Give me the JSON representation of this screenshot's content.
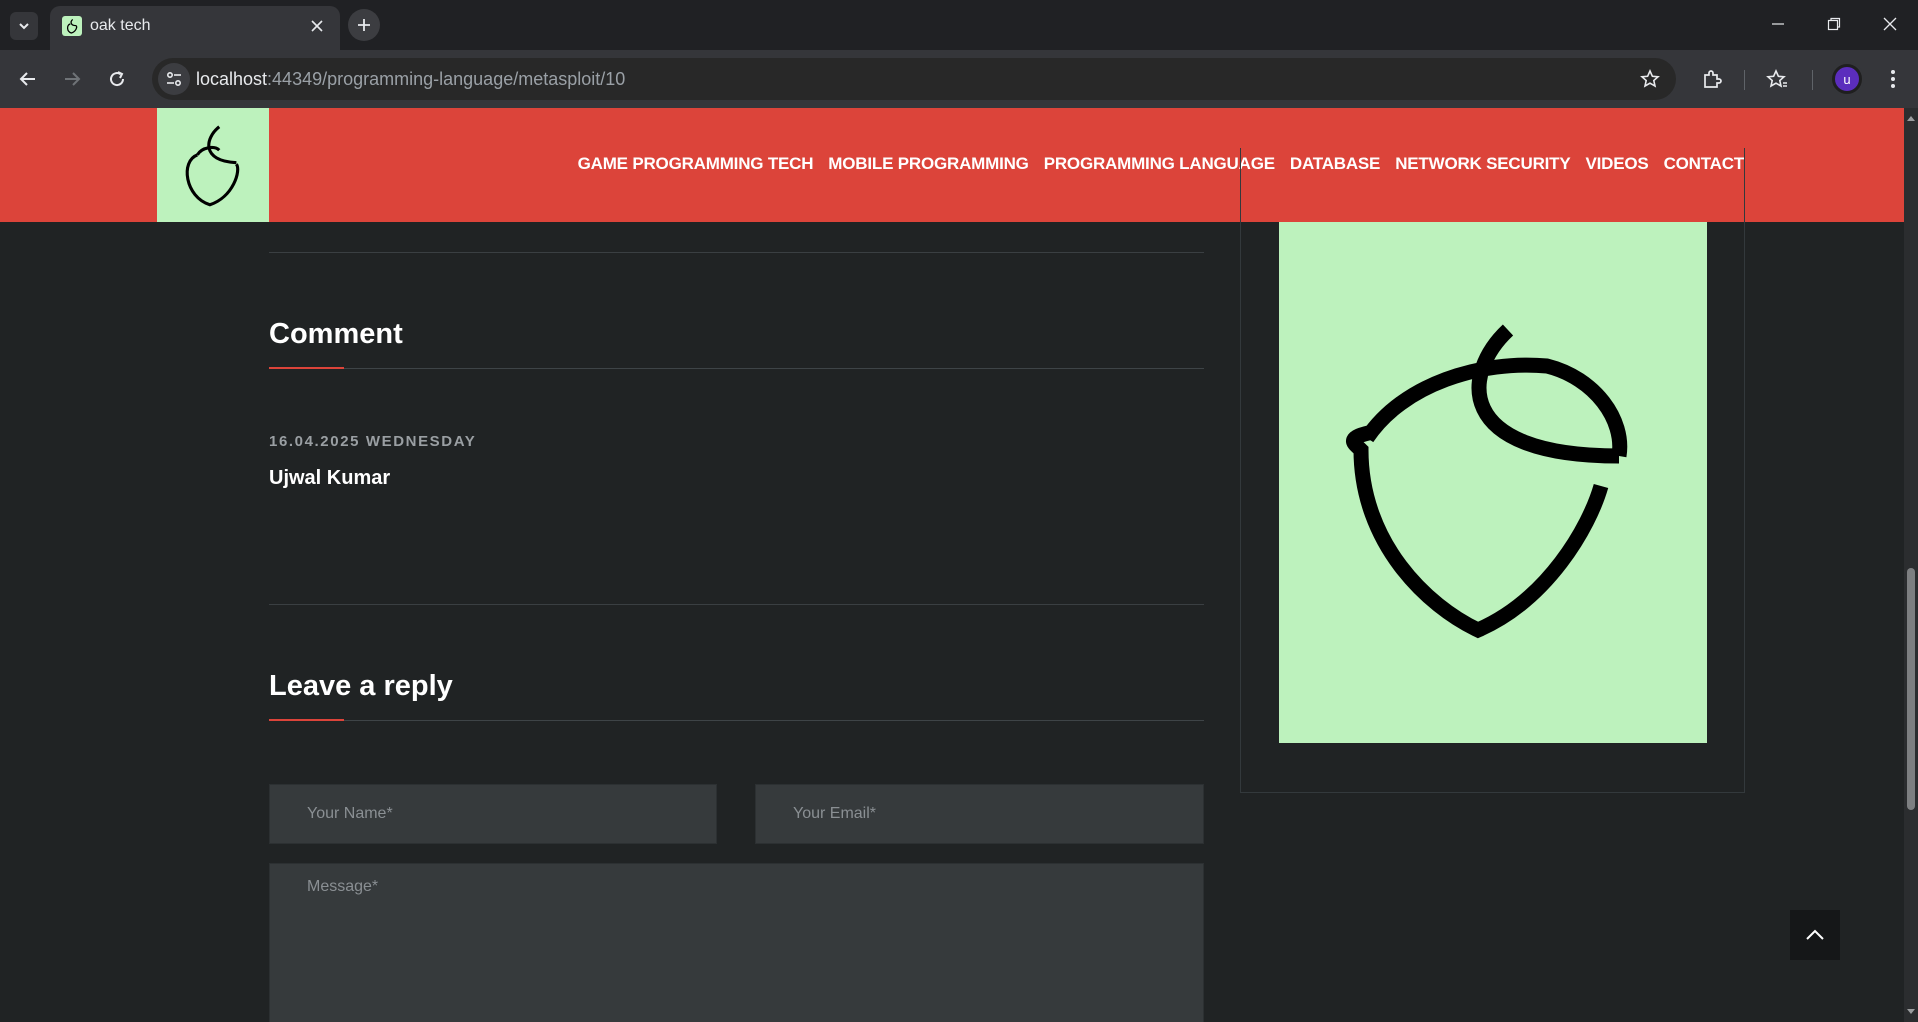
{
  "browser": {
    "tab": {
      "title": "oak tech"
    },
    "address_bar": {
      "host": "localhost",
      "path": ":44349/programming-language/metasploit/10"
    },
    "profile_initial": "u"
  },
  "site": {
    "nav": [
      "GAME PROGRAMMING TECH",
      "MOBILE PROGRAMMING",
      "PROGRAMMING LANGUAGE",
      "DATABASE",
      "NETWORK SECURITY",
      "VIDEOS",
      "CONTACT"
    ],
    "brand_color": "#dc443a",
    "logo_bg_color": "#bdf2bd"
  },
  "comments": {
    "heading": "Comment",
    "items": [
      {
        "date": "16.04.2025 WEDNESDAY",
        "author": "Ujwal Kumar"
      }
    ]
  },
  "reply_form": {
    "heading": "Leave a reply",
    "name_placeholder": "Your Name*",
    "email_placeholder": "Your Email*",
    "message_placeholder": "Message*"
  },
  "icons": {
    "logo": "acorn-icon",
    "back_to_top": "chevron-up-icon"
  }
}
